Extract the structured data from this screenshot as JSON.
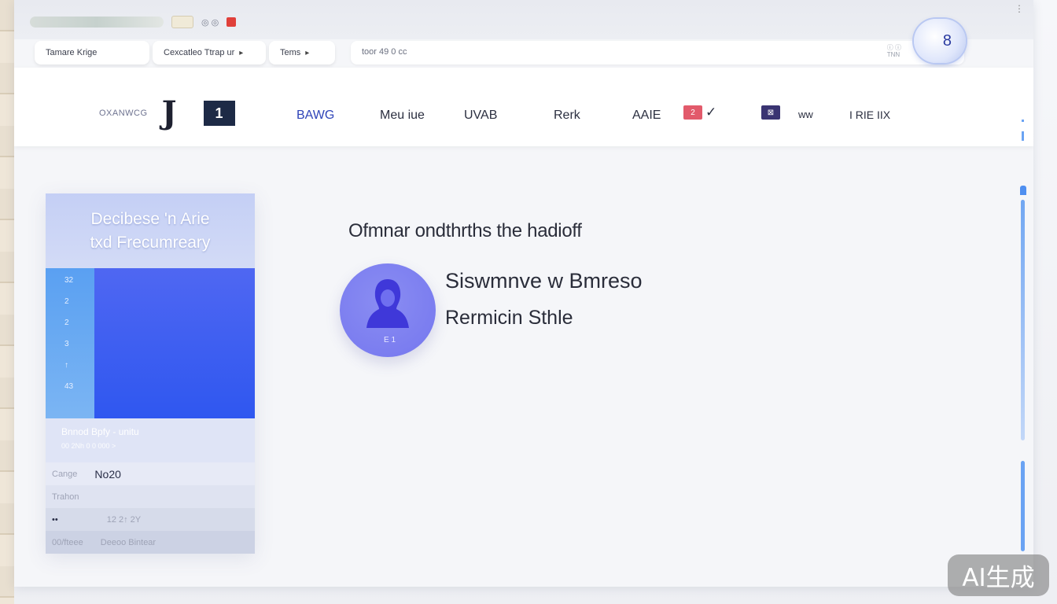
{
  "browser": {
    "favicon_text": "◎ ◎",
    "window_control": "⋮",
    "bookmarks": [
      {
        "label": "Tamare Krige"
      },
      {
        "label": "Cexcatleo Ttrap ur"
      },
      {
        "label": "Tems"
      }
    ],
    "url": "toor 49 0 cc",
    "url_hint_1": "ⓘ ⓘ",
    "url_hint_2": "TNN",
    "extension_badge": "8"
  },
  "nav": {
    "brand_name": "OXANWCG",
    "brand_mark": "J",
    "brand_box": "1",
    "items": [
      {
        "label": "BAWG"
      },
      {
        "label": "Meu iue"
      },
      {
        "label": "UVAB"
      },
      {
        "label": "Rerk"
      },
      {
        "label": "AAIE"
      },
      {
        "label": "ww"
      },
      {
        "label": "I RIE IIX"
      }
    ],
    "badge_1": "2",
    "badge_2": "⊠",
    "check_icon": "✓"
  },
  "card": {
    "title_line1": "Decibese 'n Arie",
    "title_line2": "txd Frecumreary",
    "info_title": "Bnnod Bpfy - unitu",
    "info_sub": "00 2Nh 0 0 000 >",
    "rows": [
      {
        "label": "Cange",
        "value": "No20"
      },
      {
        "label": "Trahon",
        "value": ""
      },
      {
        "label": "••",
        "value": "12 2↑ 2Y"
      },
      {
        "label": "00/fteee",
        "value": "Deeoo Bintear"
      }
    ]
  },
  "chart_data": {
    "type": "bar",
    "ytick_labels": [
      "32",
      "2",
      "2",
      "3",
      "↑",
      "43"
    ],
    "values": [
      100
    ],
    "colors": {
      "bar_top": "#4f67f2",
      "bar_bottom": "#2f57f0",
      "axis": "#5aa0f2"
    }
  },
  "main": {
    "title": "Ofmnar ondthrths the hadioff",
    "avatar_label": "E 1",
    "person_name": "Siswmnve w Bmreso",
    "person_role": "Rermicin Sthle"
  },
  "watermark": "AI生成"
}
